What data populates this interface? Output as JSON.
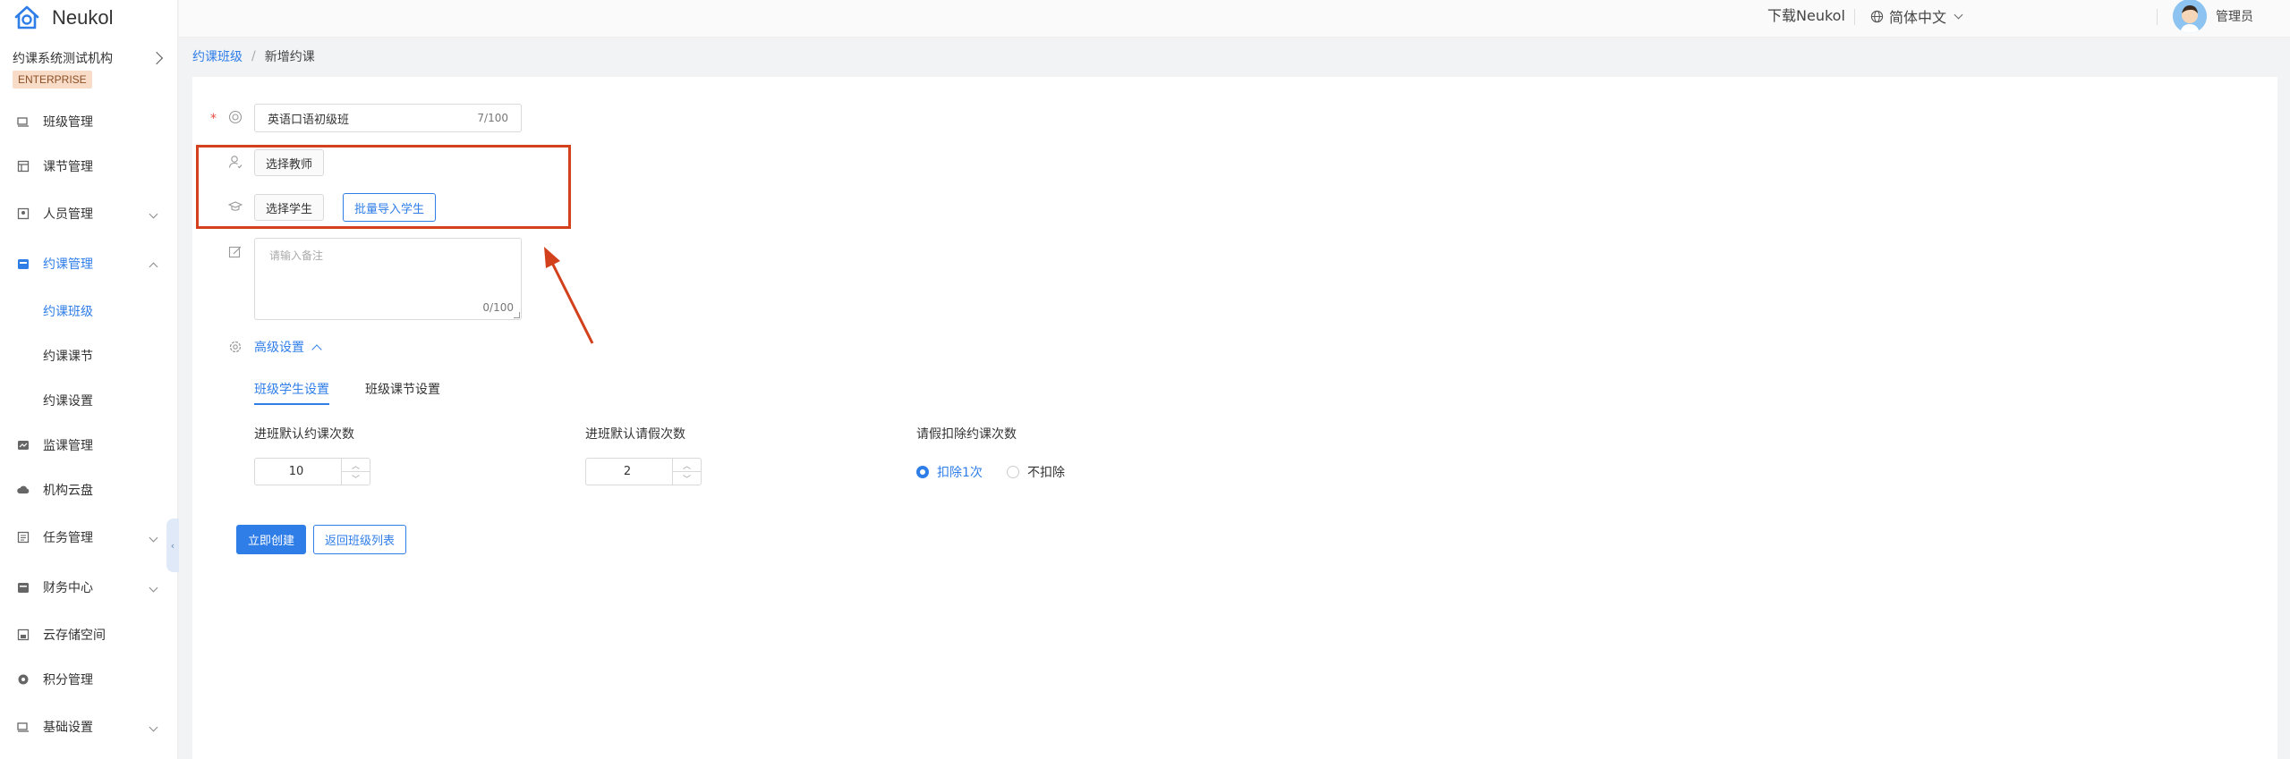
{
  "brand": {
    "name": "Neukol"
  },
  "org": {
    "name": "约课系统测试机构",
    "badge": "ENTERPRISE"
  },
  "sidebar": {
    "items": [
      {
        "label": "班级管理",
        "icon": "class-icon"
      },
      {
        "label": "课节管理",
        "icon": "lesson-icon"
      },
      {
        "label": "人员管理",
        "icon": "people-icon"
      },
      {
        "label": "约课管理",
        "icon": "booking-icon"
      },
      {
        "label": "约课班级"
      },
      {
        "label": "约课课节"
      },
      {
        "label": "约课设置"
      },
      {
        "label": "监课管理",
        "icon": "monitor-icon"
      },
      {
        "label": "机构云盘",
        "icon": "cloud-icon"
      },
      {
        "label": "任务管理",
        "icon": "task-icon"
      },
      {
        "label": "财务中心",
        "icon": "finance-icon"
      },
      {
        "label": "云存储空间",
        "icon": "storage-icon"
      },
      {
        "label": "积分管理",
        "icon": "points-icon"
      },
      {
        "label": "基础设置",
        "icon": "settings-icon"
      }
    ],
    "active_item": "约课班级"
  },
  "topbar": {
    "download": "下载Neukol",
    "language": "简体中文",
    "user": "管理员"
  },
  "breadcrumb": {
    "parent": "约课班级",
    "separator": "/",
    "current": "新增约课"
  },
  "form": {
    "class_name": {
      "value": "英语口语初级班",
      "count": "7/100"
    },
    "select_teacher": "选择教师",
    "select_student": "选择学生",
    "batch_import": "批量导入学生",
    "remark": {
      "placeholder": "请输入备注",
      "count": "0/100"
    },
    "advanced": "高级设置",
    "tabs": [
      "班级学生设置",
      "班级课节设置"
    ],
    "active_tab": "班级学生设置",
    "default_booking_label": "进班默认约课次数",
    "default_booking_value": "10",
    "default_leave_label": "进班默认请假次数",
    "default_leave_value": "2",
    "leave_deduct_label": "请假扣除约课次数",
    "leave_deduct_options": [
      "扣除1次",
      "不扣除"
    ],
    "leave_deduct_selected": "扣除1次",
    "create_button": "立即创建",
    "back_button": "返回班级列表"
  },
  "colors": {
    "accent": "#2f7ee8",
    "highlight_box": "#d2401c",
    "required": "#e54d42"
  }
}
